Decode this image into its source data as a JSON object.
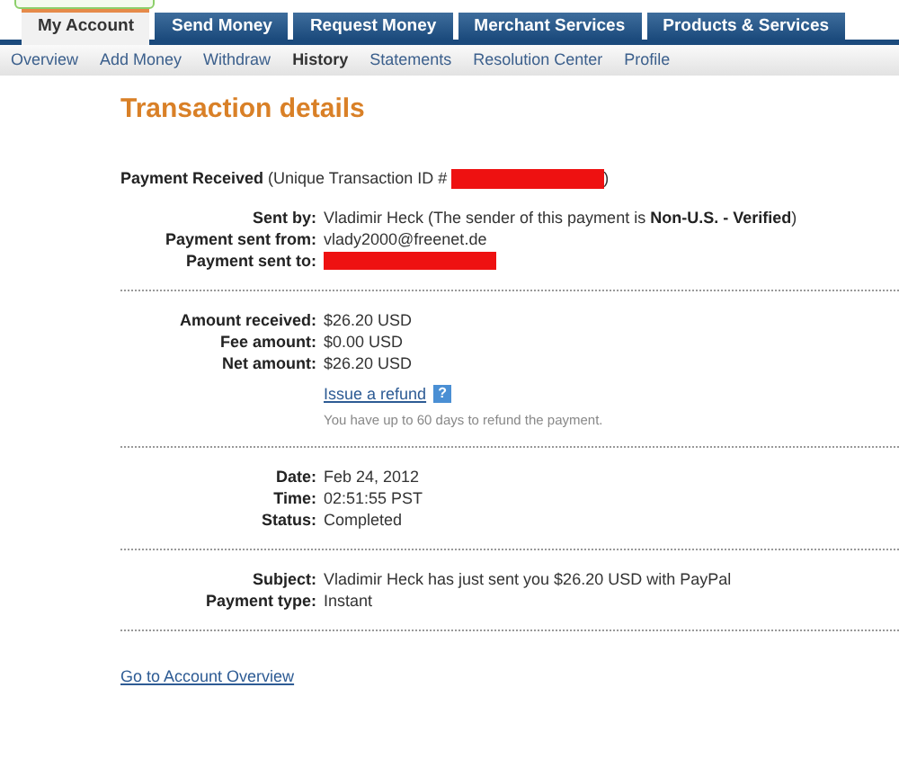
{
  "tabs": [
    {
      "label": "My Account",
      "selected": true
    },
    {
      "label": "Send Money",
      "selected": false
    },
    {
      "label": "Request Money",
      "selected": false
    },
    {
      "label": "Merchant Services",
      "selected": false
    },
    {
      "label": "Products & Services",
      "selected": false
    }
  ],
  "subnav": [
    {
      "label": "Overview",
      "selected": false
    },
    {
      "label": "Add Money",
      "selected": false
    },
    {
      "label": "Withdraw",
      "selected": false
    },
    {
      "label": "History",
      "selected": true
    },
    {
      "label": "Statements",
      "selected": false
    },
    {
      "label": "Resolution Center",
      "selected": false
    },
    {
      "label": "Profile",
      "selected": false
    }
  ],
  "title": "Transaction details",
  "heading": {
    "label": "Payment Received",
    "text": "(Unique Transaction ID #",
    "closing": ")",
    "redacted": true
  },
  "sections": [
    {
      "rows": [
        {
          "label": "Sent by:",
          "value": "Vladimir Heck (The sender of this payment is **Non-U.S. - Verified**)",
          "redacted": false
        },
        {
          "label": "Payment sent from:",
          "value": "vlady2000@freenet.de",
          "redacted": false
        },
        {
          "label": "Payment sent to:",
          "redacted": true
        }
      ]
    },
    {
      "rows": [
        {
          "label": "Amount received:",
          "value": "$26.20 USD",
          "redacted": false
        },
        {
          "label": "Fee amount:",
          "value": "$0.00 USD",
          "redacted": false
        },
        {
          "label": "Net amount:",
          "value": "$26.20 USD",
          "redacted": false
        }
      ],
      "refund": {
        "link": "Issue a refund",
        "help": "?",
        "note": "You have up to 60 days to refund the payment."
      }
    },
    {
      "rows": [
        {
          "label": "Date:",
          "value": "Feb 24, 2012",
          "redacted": false
        },
        {
          "label": "Time:",
          "value": "02:51:55 PST",
          "redacted": false
        },
        {
          "label": "Status:",
          "value": "Completed",
          "redacted": false
        }
      ]
    },
    {
      "rows": [
        {
          "label": "Subject:",
          "value": "Vladimir Heck has just sent you $26.20 USD with PayPal",
          "redacted": false
        },
        {
          "label": "Payment type:",
          "value": "Instant",
          "redacted": false
        }
      ]
    }
  ],
  "footer_link": "Go to Account Overview"
}
